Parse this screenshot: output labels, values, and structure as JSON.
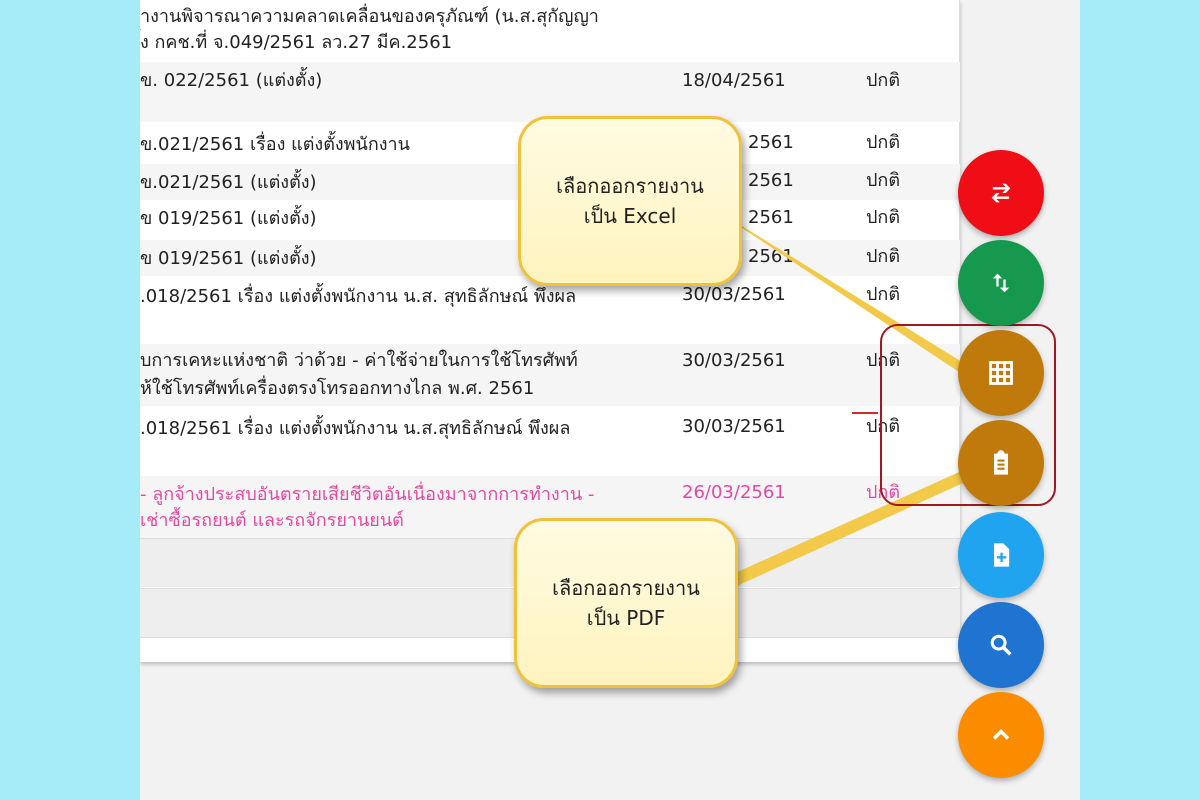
{
  "table": {
    "rows": [
      {
        "title_line1": "างานพิจารณาความคลาดเคลื่อนของครุภัณฑ์ (น.ส.สุกัญญา",
        "title_line2": "้ง กคช.ที่ จ.049/2561 ลว.27 มีค.2561",
        "date": "",
        "status": ""
      },
      {
        "title_line1": "ข. 022/2561 (แต่งตั้ง)",
        "title_line2": "",
        "date": "18/04/2561",
        "status": "ปกติ"
      },
      {
        "title_line1": "ข.021/2561 เรื่อง แต่งตั้งพนักงาน",
        "title_line2": "",
        "date": "2561",
        "status": "ปกติ"
      },
      {
        "title_line1": "ข.021/2561 (แต่งตั้ง)",
        "title_line2": "",
        "date": "2561",
        "status": "ปกติ"
      },
      {
        "title_line1": "ข 019/2561 (แต่งตั้ง)",
        "title_line2": "",
        "date": "2561",
        "status": "ปกติ"
      },
      {
        "title_line1": "ข 019/2561 (แต่งตั้ง)",
        "title_line2": "",
        "date": "2561",
        "status": "ปกติ"
      },
      {
        "title_line1": ".018/2561 เรื่อง แต่งตั้งพนักงาน น.ส. สุทธิลักษณ์ พึงผล",
        "title_line2": "",
        "date": "30/03/2561",
        "status": "ปกติ"
      },
      {
        "title_line1": "บการเคหะแห่งชาติ ว่าด้วย - ค่าใช้จ่ายในการใช้โทรศัพท์",
        "title_line2": "ห้ใช้โทรศัพท์เครื่องตรงโทรออกทางไกล พ.ศ. 2561",
        "date": "30/03/2561",
        "status": "ปกติ"
      },
      {
        "title_line1": ".018/2561 เรื่อง แต่งตั้งพนักงาน น.ส.สุทธิลักษณ์ พึงผล",
        "title_line2": "",
        "date": "30/03/2561",
        "status": "ปกติ"
      },
      {
        "title_line1": "- ลูกจ้างประสบอันตรายเสียชีวิตอันเนื่องมาจากการทำงาน -",
        "title_line2": "เช่าซื้อรถยนต์ และรถจักรยานยนต์",
        "date": "26/03/2561",
        "status": "ปกติ"
      }
    ]
  },
  "callouts": {
    "excel": {
      "line1": "เลือกออกรายงาน",
      "line2": "เป็น Excel"
    },
    "pdf": {
      "line1": "เลือกออกรายงาน",
      "line2": "เป็น PDF"
    }
  },
  "fabs": [
    {
      "icon": "swap-icon",
      "color": "#ef0d16"
    },
    {
      "icon": "sort-icon",
      "color": "#16984f"
    },
    {
      "icon": "grid-icon",
      "color": "#c07a0c"
    },
    {
      "icon": "clipboard-icon",
      "color": "#c07a0c"
    },
    {
      "icon": "file-add-icon",
      "color": "#21a4f0"
    },
    {
      "icon": "search-icon",
      "color": "#1f74d2"
    },
    {
      "icon": "chevron-up-icon",
      "color": "#fb8c00"
    }
  ],
  "colors": {
    "background": "#a6ecf8",
    "highlight_text": "#e24aa2",
    "callout_border": "#f0c23a",
    "highlight_box": "#a01822"
  }
}
